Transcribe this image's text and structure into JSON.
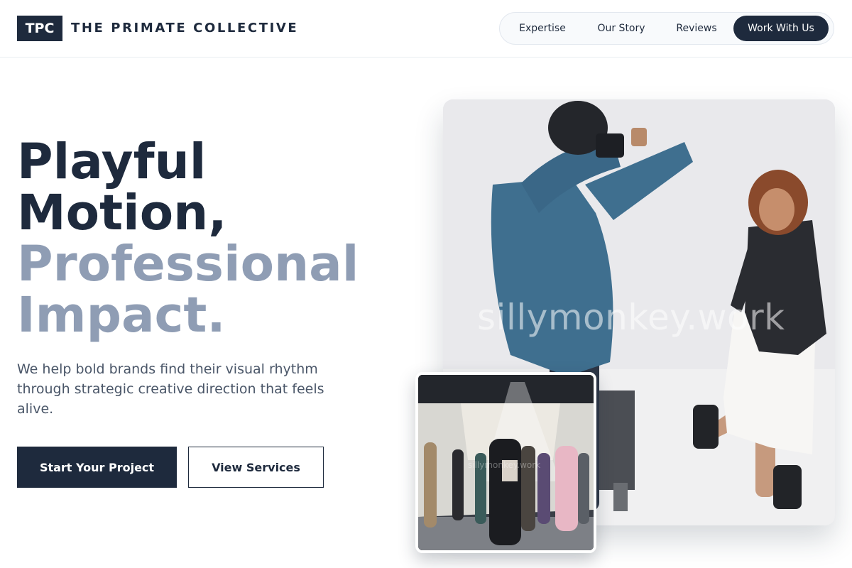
{
  "brand": {
    "logo_text": "TPC",
    "name": "THE PRIMATE COLLECTIVE"
  },
  "nav": {
    "items": [
      {
        "label": "Expertise"
      },
      {
        "label": "Our Story"
      },
      {
        "label": "Reviews"
      }
    ],
    "cta_label": "Work With Us"
  },
  "hero": {
    "headline_line1": "Playful",
    "headline_line2": "Motion,",
    "headline_line3": "Professional",
    "headline_line4": "Impact.",
    "subtext": "We help bold brands find their visual rhythm through strategic creative direction that feels alive.",
    "primary_button": "Start Your Project",
    "secondary_button": "View Services"
  },
  "images": {
    "main_watermark": "sillymonkey.work",
    "inset_watermark": "sillymonkey.work"
  },
  "colors": {
    "navy": "#1e2a3d",
    "slate": "#8f9db4",
    "body_text": "#4a5668"
  }
}
